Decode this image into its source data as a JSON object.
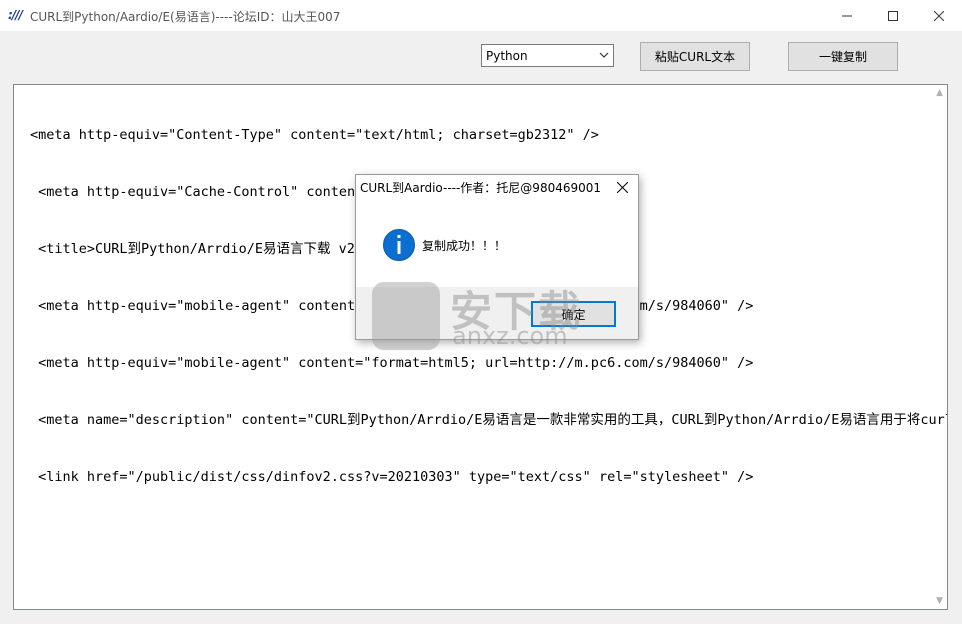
{
  "window": {
    "title": "CURL到Python/Aardio/E(易语言)----论坛ID：山大王007",
    "icon": "slash-logo-icon",
    "icon_glyph": ":///"
  },
  "toolbar": {
    "language_select": {
      "value": "Python",
      "options": [
        "Python"
      ]
    },
    "paste_label": "粘贴CURL文本",
    "copy_label": "一键复制"
  },
  "editor": {
    "lines": [
      "<meta http-equiv=\"Content-Type\" content=\"text/html; charset=gb2312\" />",
      " <meta http-equiv=\"Cache-Control\" content=\"no-transform\" />",
      " <title>CURL到Python/Arrdio/E易语言下载 v20210307免费版--pc6下载站</title>",
      " <meta http-equiv=\"mobile-agent\" content=\"format=xhtml; url=http://m.pc6.com/s/984060\" />",
      " <meta http-equiv=\"mobile-agent\" content=\"format=html5; url=http://m.pc6.com/s/984060\" />",
      " <meta name=\"description\" content=\"CURL到Python/Arrdio/E易语言是一款非常实用的工具，CURL到Python/Arrdio/E易语言用于将curl",
      " <link href=\"/public/dist/css/dinfov2.css?v=20210303\" type=\"text/css\" rel=\"stylesheet\" />"
    ]
  },
  "dialog": {
    "title": "CURL到Aardio----作者：托尼@980469001",
    "icon": "info-icon",
    "message": "复制成功！！！",
    "ok_label": "确定"
  },
  "watermark": {
    "text_cn": "安下载",
    "text_en": "anxz.com"
  },
  "colors": {
    "window_bg": "#f0f0f0",
    "dialog_accent": "#0078d7",
    "info_icon": "#0a6fd1"
  }
}
